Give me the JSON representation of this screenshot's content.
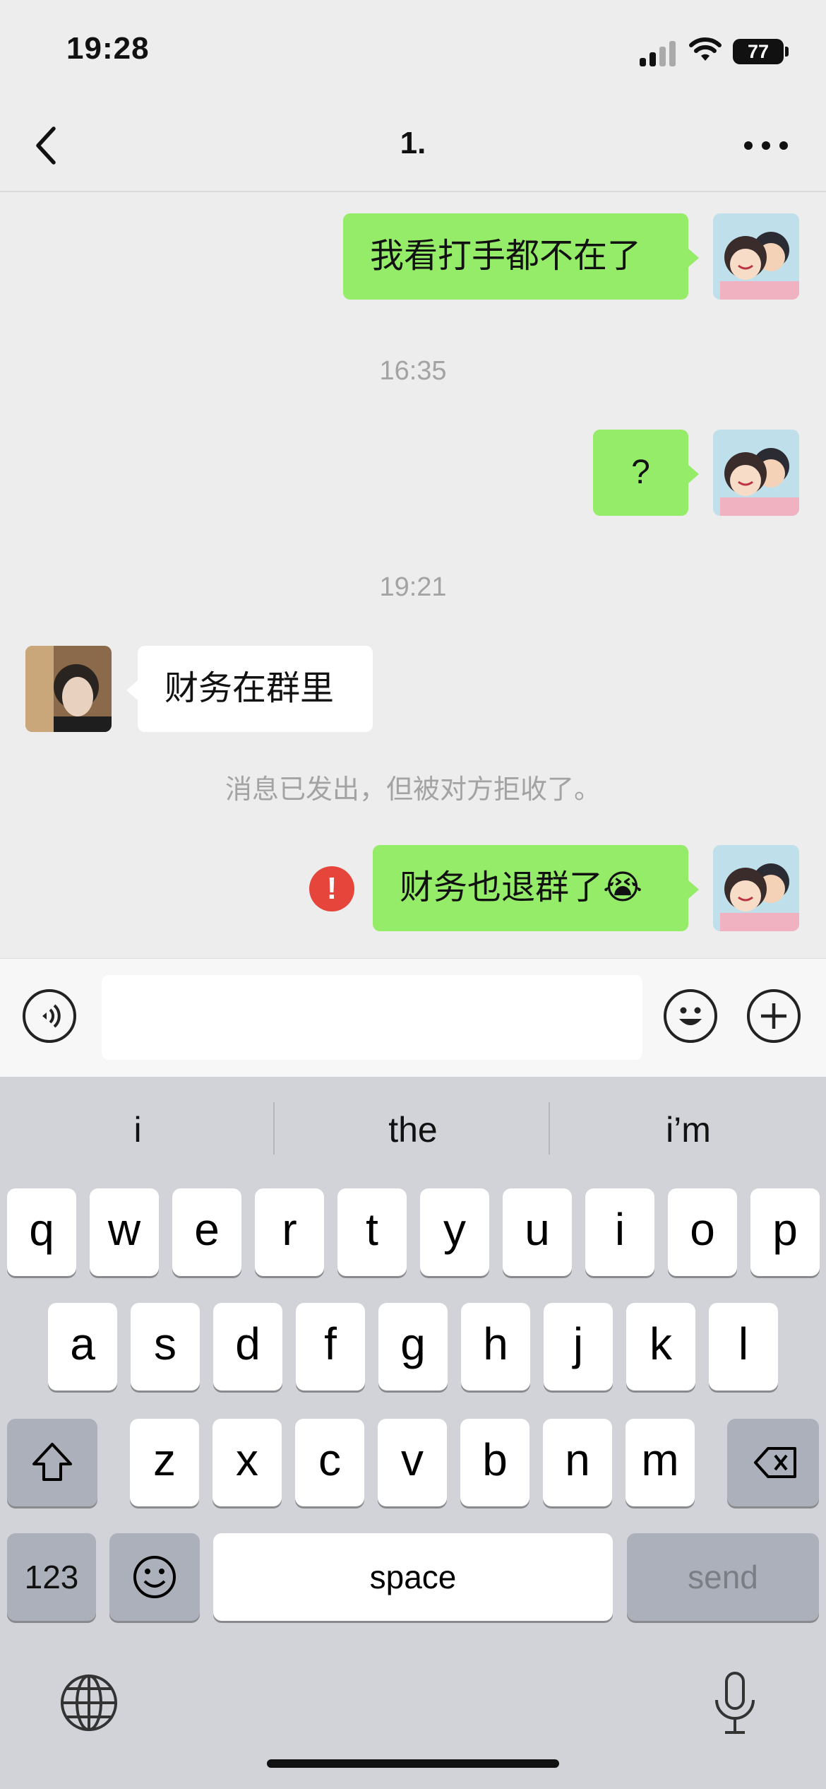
{
  "status_bar": {
    "time": "19:28",
    "battery": "77"
  },
  "nav": {
    "title": "1."
  },
  "messages": [
    {
      "side": "me",
      "text": "我看打手都不在了"
    },
    {
      "type": "time",
      "text": "16:35"
    },
    {
      "side": "me",
      "text": "?"
    },
    {
      "type": "time",
      "text": "19:21"
    },
    {
      "side": "other",
      "text": "财务在群里"
    },
    {
      "type": "system",
      "text": "消息已发出，但被对方拒收了。"
    },
    {
      "side": "me",
      "text": "财务也退群了😭",
      "failed": true,
      "error_mark": "!"
    }
  ],
  "input": {
    "value": "",
    "placeholder": ""
  },
  "keyboard": {
    "suggestions": [
      "i",
      "the",
      "i’m"
    ],
    "row1": [
      "q",
      "w",
      "e",
      "r",
      "t",
      "y",
      "u",
      "i",
      "o",
      "p"
    ],
    "row2": [
      "a",
      "s",
      "d",
      "f",
      "g",
      "h",
      "j",
      "k",
      "l"
    ],
    "row3": [
      "z",
      "x",
      "c",
      "v",
      "b",
      "n",
      "m"
    ],
    "numbers_label": "123",
    "space_label": "space",
    "send_label": "send"
  },
  "colors": {
    "my_bubble": "#95ec69",
    "their_bubble": "#ffffff",
    "error": "#e5453a",
    "background": "#ededed",
    "keyboard": "#d1d3d9"
  }
}
